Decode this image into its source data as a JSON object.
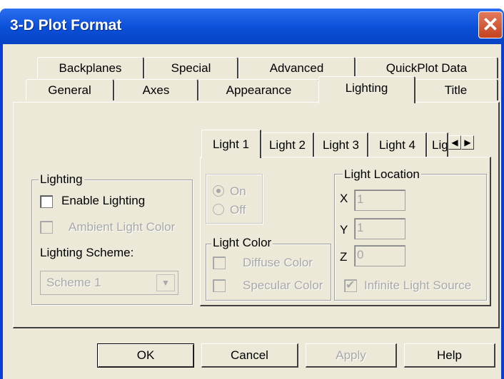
{
  "window": {
    "title": "3-D Plot Format",
    "close_glyph": "✕"
  },
  "tabs_back": [
    "Backplanes",
    "Special",
    "Advanced",
    "QuickPlot Data"
  ],
  "tabs_front": [
    "General",
    "Axes",
    "Appearance",
    "Lighting",
    "Title"
  ],
  "selected_tab": "Lighting",
  "lighting_group": {
    "title": "Lighting",
    "enable": "Enable Lighting",
    "ambient": "Ambient Light Color",
    "scheme_label": "Lighting Scheme:",
    "scheme_value": "Scheme 1"
  },
  "light_tabs": [
    "Light 1",
    "Light 2",
    "Light 3",
    "Light 4",
    "Lig"
  ],
  "onoff": {
    "on": "On",
    "off": "Off"
  },
  "light_color": {
    "title": "Light Color",
    "diffuse": "Diffuse Color",
    "specular": "Specular Color"
  },
  "light_location": {
    "title": "Light Location",
    "x_label": "X",
    "x_value": "1",
    "y_label": "Y",
    "y_value": "1",
    "z_label": "Z",
    "z_value": "0",
    "infinite": "Infinite Light Source"
  },
  "buttons": {
    "ok": "OK",
    "cancel": "Cancel",
    "apply": "Apply",
    "help": "Help"
  }
}
